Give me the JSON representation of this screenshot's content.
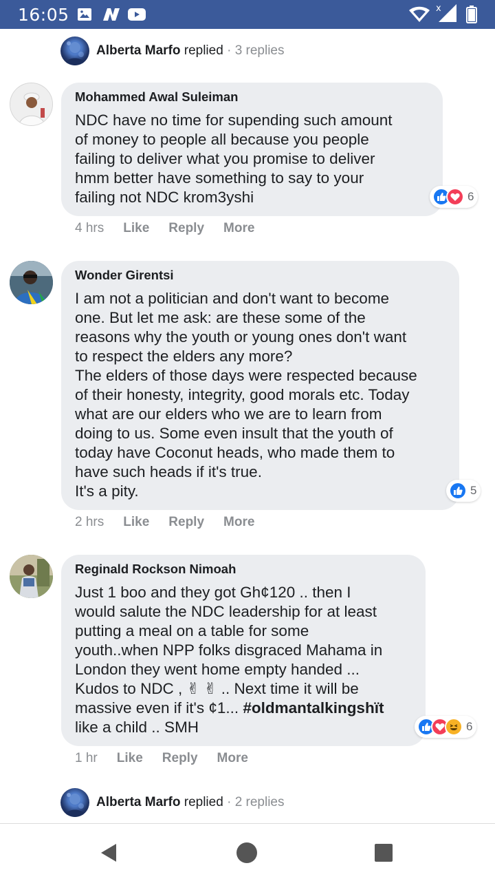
{
  "status_bar": {
    "time": "16:05",
    "icons": [
      "image-icon",
      "n-app-icon",
      "youtube-icon",
      "wifi-icon",
      "signal-icon",
      "battery-icon"
    ]
  },
  "colors": {
    "status_bar_bg": "#3b5a9a",
    "bubble_bg": "#ebedf0",
    "like_blue": "#1877f2",
    "love_red": "#f33e58",
    "haha_yellow": "#f7b125",
    "meta_gray": "#8a8d91"
  },
  "top_reply": {
    "name": "Alberta Marfo",
    "action": "replied",
    "separator": "·",
    "count": "3 replies"
  },
  "comments": [
    {
      "author": "Mohammed Awal Suleiman",
      "lines": [
        "NDC have no time for supending such amount",
        "of money to people all because you people",
        "failing to deliver what you promise to deliver",
        "hmm better have something to say to your",
        "failing not NDC krom3yshi"
      ],
      "reactions": [
        "like",
        "love"
      ],
      "reaction_count": "6",
      "time": "4 hrs",
      "like": "Like",
      "reply": "Reply",
      "more": "More"
    },
    {
      "author": "Wonder Girentsi",
      "lines": [
        "I am not a politician and don't want to become",
        "one. But let me ask: are these some of the",
        "reasons why the youth or young ones don't want",
        "to respect the elders any more?",
        "The elders of those days were respected because",
        "of their honesty, integrity, good morals etc. Today",
        "what are our elders who we are to learn from",
        "doing to us. Some even insult that the youth of",
        "today have Coconut heads, who made them to",
        "have such heads if it's true.",
        "It's a pity."
      ],
      "reactions": [
        "like"
      ],
      "reaction_count": "5",
      "time": "2 hrs",
      "like": "Like",
      "reply": "Reply",
      "more": "More"
    },
    {
      "author": "Reginald Rockson Nimoah",
      "lines": [
        "Just 1 boo and they got Gh¢120 .. then I",
        "would salute the NDC leadership for at least",
        "putting a meal on a table for some",
        "youth..when NPP folks disgraced Mahama in",
        "London they went home empty handed ...",
        "Kudos to NDC , ✌ ✌ .. Next time it will be",
        "massive even if it's ¢1...",
        "like a child .. SMH"
      ],
      "hashtag": "#oldmantalkingshït",
      "reactions": [
        "like",
        "love",
        "haha"
      ],
      "reaction_count": "6",
      "time": "1 hr",
      "like": "Like",
      "reply": "Reply",
      "more": "More"
    }
  ],
  "bottom_reply": {
    "name": "Alberta Marfo",
    "action": "replied",
    "separator": "·",
    "count": "2 replies"
  },
  "nav": {
    "back": "back-icon",
    "home": "home-icon",
    "recents": "recents-icon"
  }
}
